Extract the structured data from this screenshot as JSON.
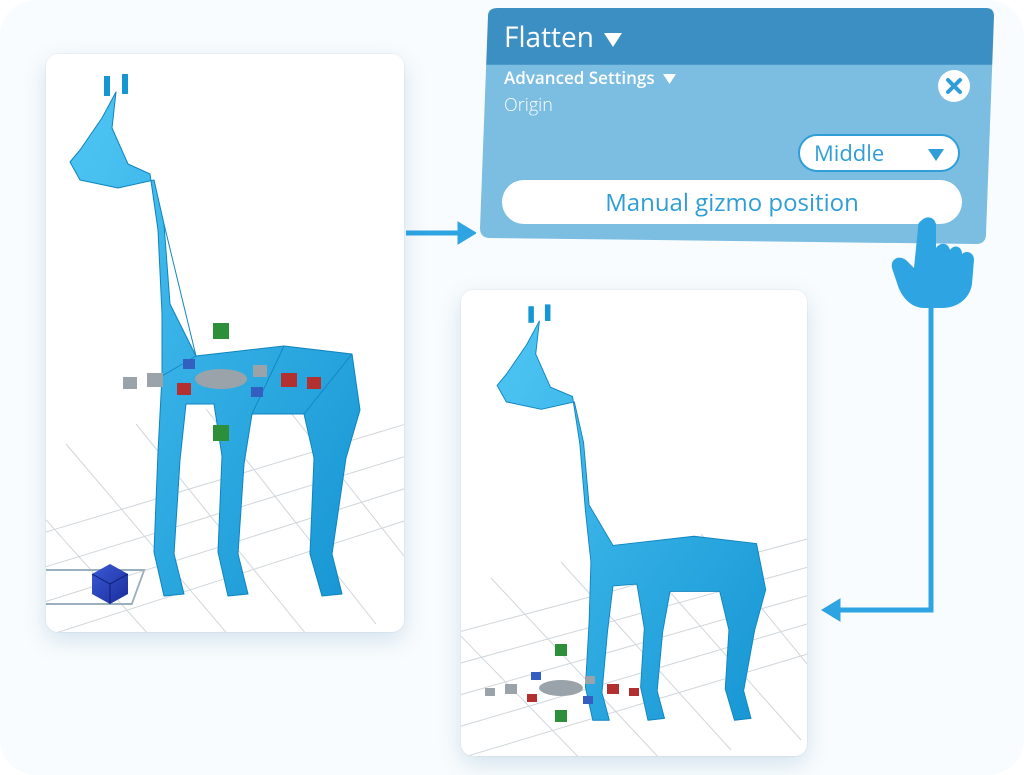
{
  "panel": {
    "title": "Flatten",
    "section": "Advanced Settings",
    "field_label": "Origin",
    "dropdown_value": "Middle",
    "button_label": "Manual gizmo position"
  },
  "icons": {
    "close": "close-icon",
    "expand_title": "caret-down-icon",
    "expand_section": "caret-down-icon",
    "dropdown_caret": "caret-down-icon",
    "cursor": "pointer-cursor"
  },
  "viewports": {
    "before": {
      "desc": "model-with-gizmo-at-center"
    },
    "after": {
      "desc": "model-with-gizmo-at-floor"
    }
  },
  "colors": {
    "accent": "#2ea4e2",
    "panel_dark": "#3c8fc2",
    "panel_light": "#7cbde2"
  }
}
